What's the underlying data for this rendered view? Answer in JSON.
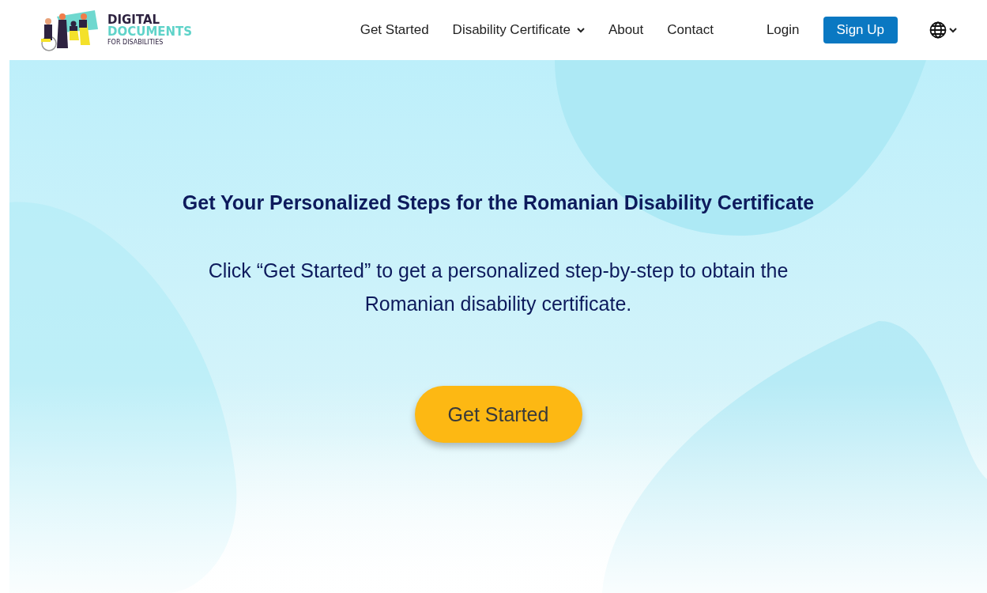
{
  "logo": {
    "line_1": "DIGITAL",
    "line_2": "DOCUMENTS",
    "line_3": "FOR DISABILITIES"
  },
  "nav": [
    {
      "label": "Get Started",
      "kind": "link"
    },
    {
      "label": "Disability Certificate",
      "kind": "dropdown"
    },
    {
      "label": "About",
      "kind": "link"
    },
    {
      "label": "Contact",
      "kind": "link"
    }
  ],
  "login": "Login",
  "signup": "Sign Up",
  "hero": {
    "title": "Get Your Personalized Steps for the Romanian Disability Certificate",
    "text": "Click “Get Started” to get a personalized step-by-step to obtain the Romanian disability certificate.",
    "button": "Get Started"
  }
}
